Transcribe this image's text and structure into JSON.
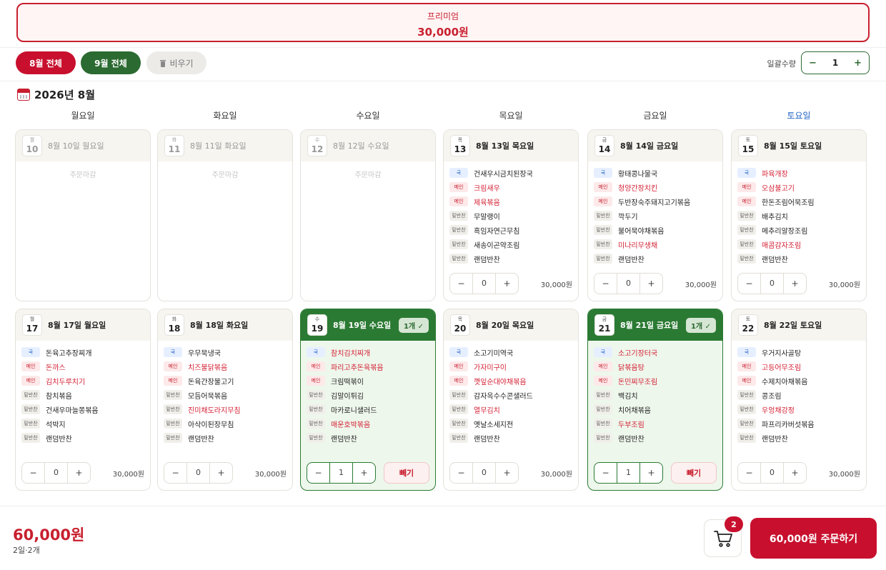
{
  "premium": {
    "title": "프리미엄",
    "price": "30,000원"
  },
  "toolbar": {
    "aug_all": "8월 전체",
    "sep_all": "9월 전체",
    "clear": "비우기",
    "bulk_label": "일괄수량",
    "bulk_minus": "−",
    "bulk_value": "1",
    "bulk_plus": "+"
  },
  "month_title": "2026년 8월",
  "weekdays": [
    "월요일",
    "화요일",
    "수요일",
    "목요일",
    "금요일",
    "토요일"
  ],
  "tags": {
    "soup": "국",
    "main": "메인",
    "side": "밑반찬"
  },
  "closed_label": "주문마감",
  "remove_label": "빼기",
  "stepper": {
    "minus": "−",
    "plus": "+"
  },
  "days": [
    {
      "wd": "월",
      "num": "10",
      "title": "8월 10일 월요일",
      "closed": true
    },
    {
      "wd": "화",
      "num": "11",
      "title": "8월 11일 화요일",
      "closed": true
    },
    {
      "wd": "수",
      "num": "12",
      "title": "8월 12일 수요일",
      "closed": true
    },
    {
      "wd": "목",
      "num": "13",
      "title": "8월 13일 목요일",
      "qty": "0",
      "price": "30,000원",
      "items": [
        [
          "soup",
          "건새우시금치된장국",
          false
        ],
        [
          "main",
          "크림새우",
          true
        ],
        [
          "main",
          "제육볶음",
          true
        ],
        [
          "side",
          "무말랭이",
          false
        ],
        [
          "side",
          "흑임자연근무침",
          false
        ],
        [
          "side",
          "새송이곤약조림",
          false
        ],
        [
          "side",
          "랜덤반찬",
          false
        ]
      ]
    },
    {
      "wd": "금",
      "num": "14",
      "title": "8월 14일 금요일",
      "qty": "0",
      "price": "30,000원",
      "items": [
        [
          "soup",
          "황태콩나물국",
          false
        ],
        [
          "main",
          "청양간장치킨",
          true
        ],
        [
          "main",
          "두반장숙주돼지고기볶음",
          false
        ],
        [
          "side",
          "깍두기",
          false
        ],
        [
          "side",
          "불어묵야채볶음",
          false
        ],
        [
          "side",
          "미나리무생채",
          true
        ],
        [
          "side",
          "랜덤반찬",
          false
        ]
      ]
    },
    {
      "wd": "토",
      "num": "15",
      "title": "8월 15일 토요일",
      "qty": "0",
      "price": "30,000원",
      "items": [
        [
          "soup",
          "파육개장",
          true
        ],
        [
          "main",
          "오삼불고기",
          true
        ],
        [
          "main",
          "한돈조림어묵조림",
          false
        ],
        [
          "side",
          "배추김치",
          false
        ],
        [
          "side",
          "메추리알장조림",
          false
        ],
        [
          "side",
          "매콤감자조림",
          true
        ],
        [
          "side",
          "랜덤반찬",
          false
        ]
      ]
    },
    {
      "wd": "월",
      "num": "17",
      "title": "8월 17일 월요일",
      "qty": "0",
      "price": "30,000원",
      "items": [
        [
          "soup",
          "돈육고추장찌개",
          false
        ],
        [
          "main",
          "돈까스",
          true
        ],
        [
          "main",
          "김치두루치기",
          true
        ],
        [
          "side",
          "참치볶음",
          false
        ],
        [
          "side",
          "건새우마늘쫑볶음",
          false
        ],
        [
          "side",
          "석박지",
          false
        ],
        [
          "side",
          "랜덤반찬",
          false
        ]
      ]
    },
    {
      "wd": "화",
      "num": "18",
      "title": "8월 18일 화요일",
      "qty": "0",
      "price": "30,000원",
      "items": [
        [
          "soup",
          "우무묵냉국",
          false
        ],
        [
          "main",
          "치즈불닭볶음",
          true
        ],
        [
          "main",
          "돈육간장불고기",
          false
        ],
        [
          "side",
          "모듬어묵볶음",
          false
        ],
        [
          "side",
          "진미채도라지무침",
          true
        ],
        [
          "side",
          "아삭이된장무침",
          false
        ],
        [
          "side",
          "랜덤반찬",
          false
        ]
      ]
    },
    {
      "wd": "수",
      "num": "19",
      "title": "8월 19일 수요일",
      "qty": "1",
      "selected": true,
      "badge": "1개 ✓",
      "items": [
        [
          "soup",
          "참치김치찌개",
          true
        ],
        [
          "main",
          "파리고추돈육볶음",
          true
        ],
        [
          "main",
          "크림떡볶이",
          false
        ],
        [
          "side",
          "김말이튀김",
          false
        ],
        [
          "side",
          "마카로니샐러드",
          false
        ],
        [
          "side",
          "매운호박볶음",
          true
        ],
        [
          "side",
          "랜덤반찬",
          false
        ]
      ]
    },
    {
      "wd": "목",
      "num": "20",
      "title": "8월 20일 목요일",
      "qty": "0",
      "price": "30,000원",
      "items": [
        [
          "soup",
          "소고기미역국",
          false
        ],
        [
          "main",
          "가자미구이",
          true
        ],
        [
          "main",
          "깻잎순대야채볶음",
          true
        ],
        [
          "side",
          "감자옥수수콘샐러드",
          false
        ],
        [
          "side",
          "열무김치",
          true
        ],
        [
          "side",
          "옛날소세지전",
          false
        ],
        [
          "side",
          "랜덤반찬",
          false
        ]
      ]
    },
    {
      "wd": "금",
      "num": "21",
      "title": "8월 21일 금요일",
      "qty": "1",
      "selected": true,
      "badge": "1개 ✓",
      "items": [
        [
          "soup",
          "소고기장터국",
          true
        ],
        [
          "main",
          "닭볶음탕",
          true
        ],
        [
          "main",
          "돈민찌무조림",
          true
        ],
        [
          "side",
          "백김치",
          false
        ],
        [
          "side",
          "치어채볶음",
          false
        ],
        [
          "side",
          "두부조림",
          true
        ],
        [
          "side",
          "랜덤반찬",
          false
        ]
      ]
    },
    {
      "wd": "토",
      "num": "22",
      "title": "8월 22일 토요일",
      "qty": "0",
      "price": "30,000원",
      "items": [
        [
          "soup",
          "우거지사골탕",
          false
        ],
        [
          "main",
          "고등어무조림",
          true
        ],
        [
          "main",
          "수제치아채볶음",
          false
        ],
        [
          "side",
          "콩조림",
          false
        ],
        [
          "side",
          "우엉채강정",
          true
        ],
        [
          "side",
          "파프리카버섯볶음",
          false
        ],
        [
          "side",
          "랜덤반찬",
          false
        ]
      ]
    }
  ],
  "footer": {
    "total": "60,000원",
    "summary": "2일·2개",
    "cart_count": "2",
    "order_label": "60,000원 주문하기"
  },
  "colors": {
    "brand_red": "#c8102e",
    "brand_green": "#2b6a31",
    "saturday_blue": "#1f63c6"
  },
  "icons": {
    "calendar": "calendar-icon",
    "trash": "trash-icon",
    "cart": "cart-icon",
    "check": "check-icon"
  }
}
